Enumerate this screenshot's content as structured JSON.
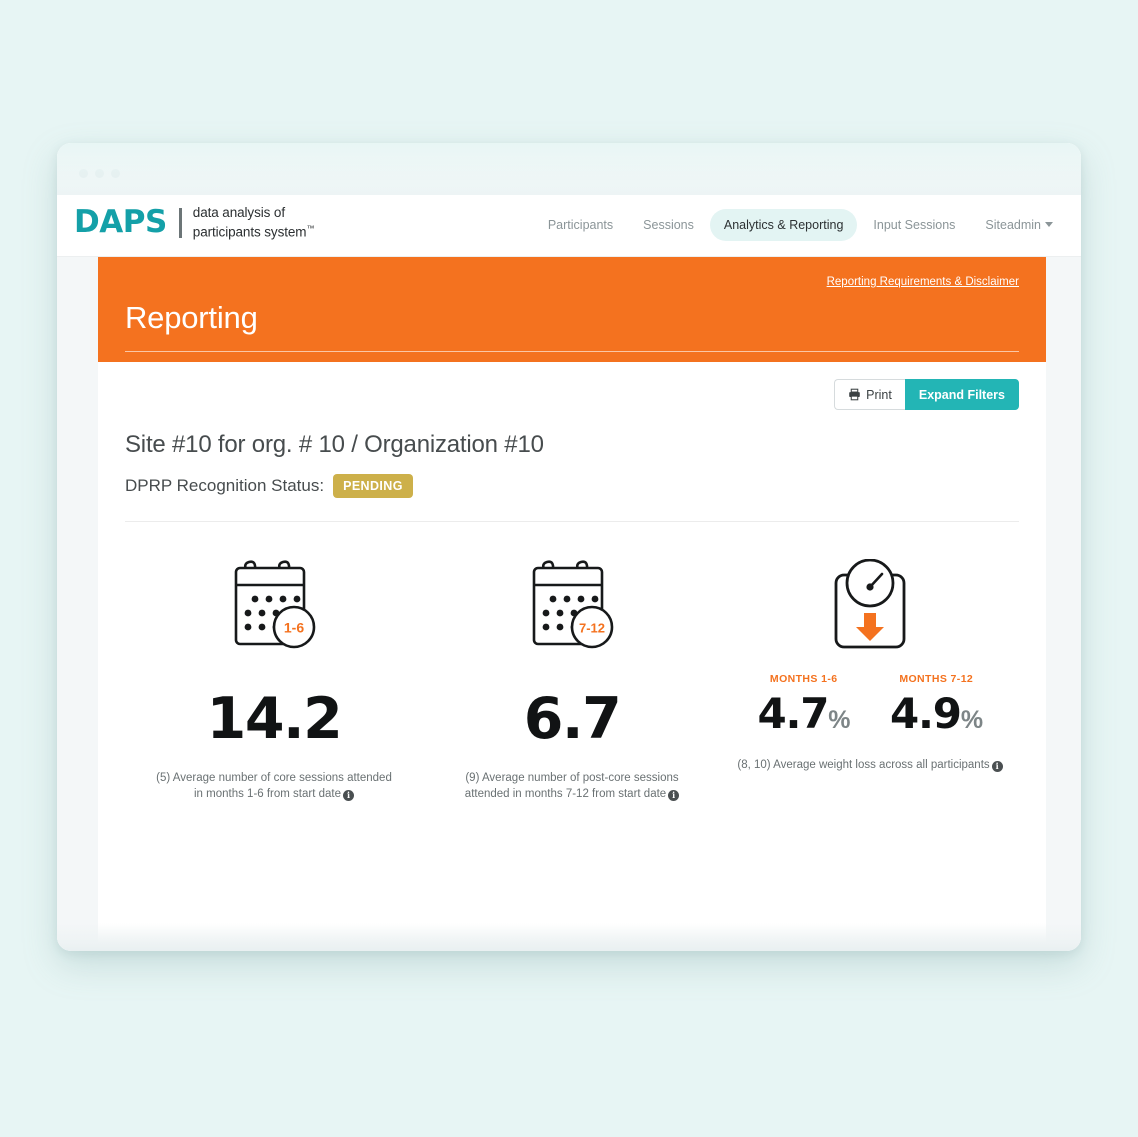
{
  "brand": {
    "logo_mark": "DAPS",
    "tagline_line1": "data analysis of",
    "tagline_line2": "participants system",
    "trademark": "™",
    "accent_teal": "#14a0a8",
    "accent_orange": "#f4721f",
    "button_teal": "#23b5b5",
    "badge_gold": "#cdb04a",
    "page_background": "#e7f5f4"
  },
  "nav": {
    "items": [
      {
        "label": "Participants",
        "active": false
      },
      {
        "label": "Sessions",
        "active": false
      },
      {
        "label": "Analytics & Reporting",
        "active": true
      },
      {
        "label": "Input Sessions",
        "active": false
      },
      {
        "label": "Siteadmin",
        "active": false,
        "has_caret": true
      }
    ]
  },
  "banner": {
    "title": "Reporting",
    "disclaimer_link": "Reporting Requirements & Disclaimer"
  },
  "toolbar": {
    "print_label": "Print",
    "print_icon": "printer-icon",
    "expand_filters_label": "Expand Filters"
  },
  "page": {
    "site_title": "Site #10 for org. # 10 / Organization #10",
    "status_label": "DPRP Recognition Status:",
    "status_badge": "PENDING"
  },
  "metrics": [
    {
      "icon": "calendar-icon",
      "icon_badge": "1-6",
      "value": "14.2",
      "caption_line1": "(5) Average number of core sessions attended in",
      "caption_line2": "months 1-6 from start date",
      "info": "info-icon"
    },
    {
      "icon": "calendar-icon",
      "icon_badge": "7-12",
      "value": "6.7",
      "caption_line1": "(9) Average number of post-core sessions attended in",
      "caption_line2": "months 7-12 from start date",
      "info": "info-icon"
    }
  ],
  "weight_metric": {
    "icon": "scale-icon",
    "subs": [
      {
        "period": "MONTHS 1-6",
        "number": "4.7",
        "unit": "%"
      },
      {
        "period": "MONTHS 7-12",
        "number": "4.9",
        "unit": "%"
      }
    ],
    "caption": "(8, 10) Average weight loss across all participants",
    "info": "info-icon"
  }
}
